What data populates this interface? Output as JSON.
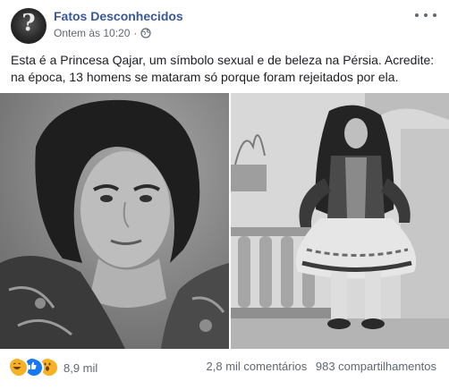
{
  "post": {
    "page_name": "Fatos Desconhecidos",
    "timestamp": "Ontem às 10:20",
    "separator": "·",
    "privacy_icon": "globe-icon",
    "text": "Esta é a Princesa Qajar, um símbolo sexual e de beleza na Pérsia. Acredite: na época, 13 homens se mataram só porque foram rejeitados por ela."
  },
  "footer": {
    "reactions": [
      "haha-icon",
      "like-icon",
      "wow-icon"
    ],
    "reaction_count": "8,9 mil",
    "comments": "2,8 mil comentários",
    "shares": "983 compartilhamentos"
  },
  "colors": {
    "page_name": "#385898",
    "meta_text": "#606770",
    "like_blue": "#1877f2",
    "emoji_yellow": "#f7b125"
  }
}
